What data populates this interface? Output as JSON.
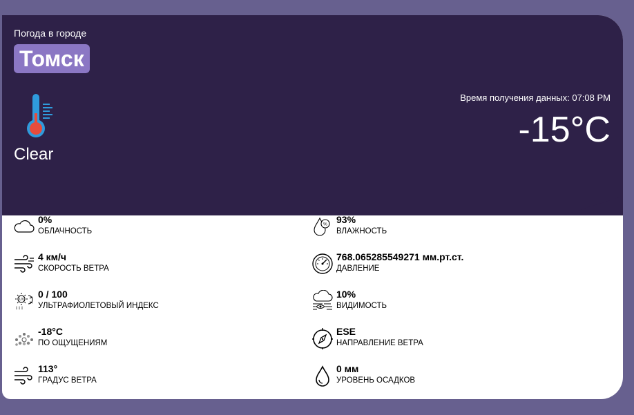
{
  "header": {
    "label": "Погода в городе",
    "city": "Томск",
    "condition": "Clear",
    "fetch_time": "Время получения данных: 07:08 PM",
    "temperature": "-15°C"
  },
  "stats": {
    "cloudiness": {
      "value": "0%",
      "label": "ОБЛАЧНОСТЬ",
      "icon": "cloud-icon"
    },
    "humidity": {
      "value": "93%",
      "label": "ВЛАЖНОСТЬ",
      "icon": "humidity-icon"
    },
    "wind_speed": {
      "value": "4 км/ч",
      "label": "СКОРОСТЬ ВЕТРА",
      "icon": "wind-icon"
    },
    "pressure": {
      "value": "768.065285549271 мм.рт.ст.",
      "label": "ДАВЛЕНИЕ",
      "icon": "gauge-icon"
    },
    "uv_index": {
      "value": "0 / 100",
      "label": "УЛЬТРАФИОЛЕТОВЫЙ ИНДЕКС",
      "icon": "uv-icon"
    },
    "visibility": {
      "value": "10%",
      "label": "ВИДИМОСТЬ",
      "icon": "visibility-icon"
    },
    "feels_like": {
      "value": "-18°C",
      "label": "ПО ОЩУЩЕНИЯМ",
      "icon": "feels-like-icon"
    },
    "wind_direction": {
      "value": "ESE",
      "label": "НАПРАВЛЕНИЕ ВЕТРА",
      "icon": "compass-icon"
    },
    "wind_degree": {
      "value": "113°",
      "label": "ГРАДУС ВЕТРА",
      "icon": "wind-degree-icon"
    },
    "precipitation": {
      "value": "0 мм",
      "label": "УРОВЕНЬ ОСАДКОВ",
      "icon": "droplet-icon"
    }
  },
  "colors": {
    "page_background": "#67608f",
    "card_header": "#2e2148",
    "city_chip": "#8b77c4",
    "thermometer_blue": "#2f9bdc",
    "thermometer_red": "#e74c3c"
  }
}
